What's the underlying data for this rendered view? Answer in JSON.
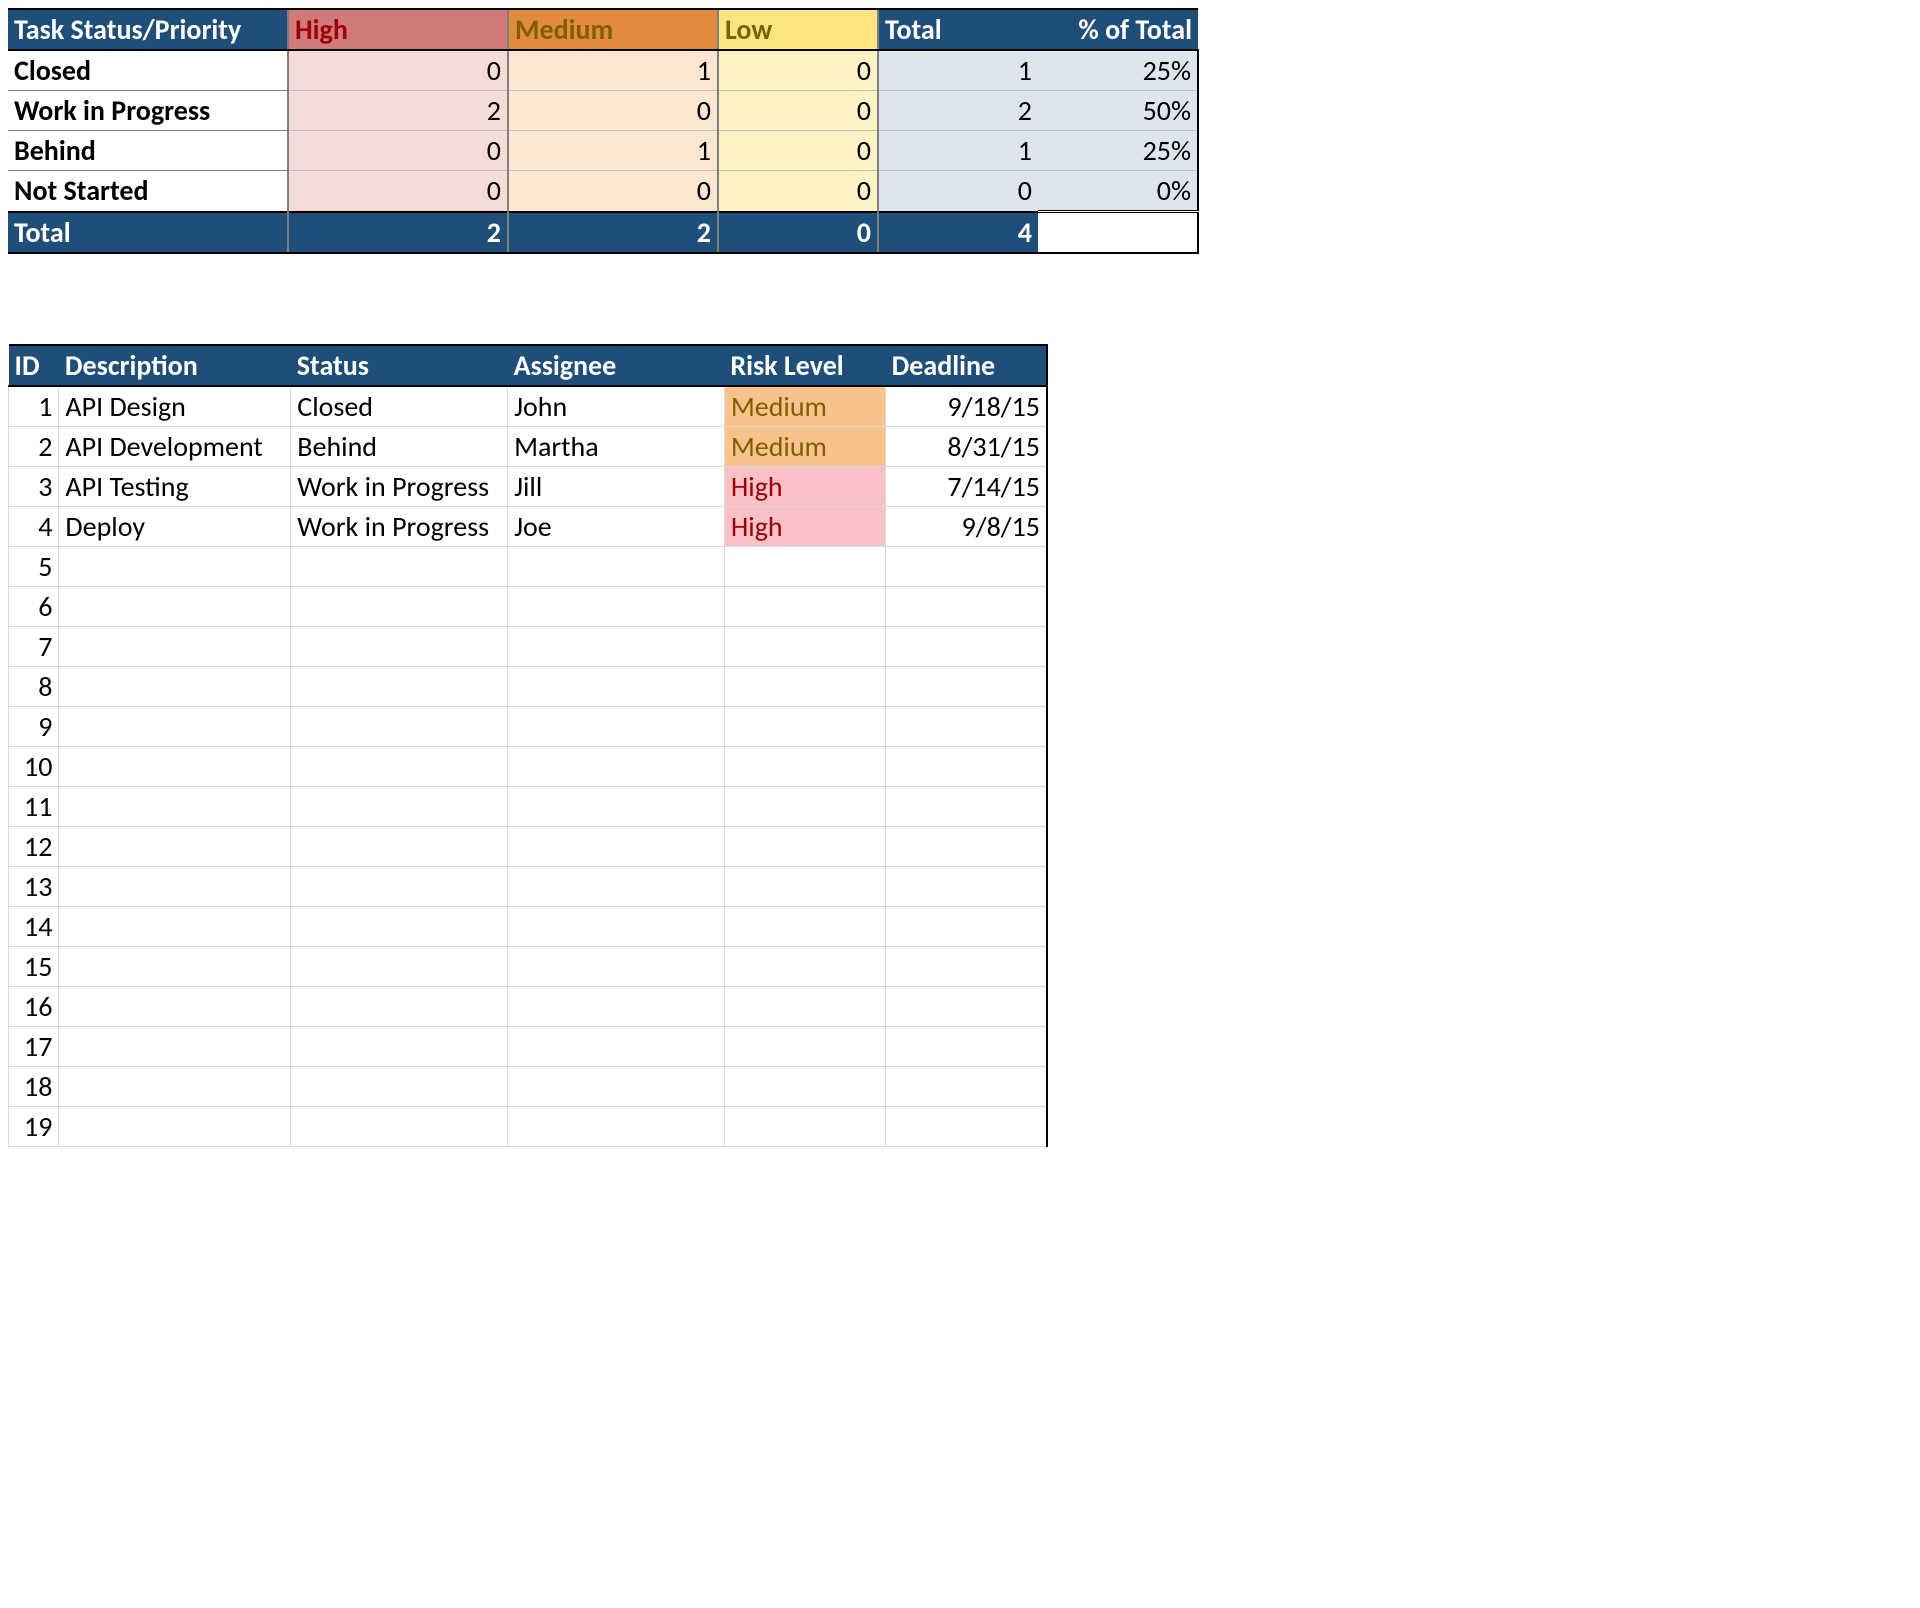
{
  "summary": {
    "headers": {
      "rowhead": "Task Status/Priority",
      "high": "High",
      "medium": "Medium",
      "low": "Low",
      "total": "Total",
      "pct": "% of Total"
    },
    "rows": [
      {
        "label": "Closed",
        "high": "0",
        "medium": "1",
        "low": "0",
        "total": "1",
        "pct": "25%"
      },
      {
        "label": "Work in Progress",
        "high": "2",
        "medium": "0",
        "low": "0",
        "total": "2",
        "pct": "50%"
      },
      {
        "label": "Behind",
        "high": "0",
        "medium": "1",
        "low": "0",
        "total": "1",
        "pct": "25%"
      },
      {
        "label": "Not Started",
        "high": "0",
        "medium": "0",
        "low": "0",
        "total": "0",
        "pct": "0%"
      }
    ],
    "totals": {
      "label": "Total",
      "high": "2",
      "medium": "2",
      "low": "0",
      "total": "4",
      "pct": ""
    }
  },
  "detail": {
    "headers": {
      "id": "ID",
      "desc": "Description",
      "status": "Status",
      "assignee": "Assignee",
      "risk": "Risk Level",
      "deadline": "Deadline"
    },
    "rows": [
      {
        "id": "1",
        "desc": "API Design",
        "status": "Closed",
        "assignee": "John",
        "risk": "Medium",
        "risk_class": "risk-med",
        "deadline": "9/18/15"
      },
      {
        "id": "2",
        "desc": "API Development",
        "status": "Behind",
        "assignee": "Martha",
        "risk": "Medium",
        "risk_class": "risk-med",
        "deadline": "8/31/15"
      },
      {
        "id": "3",
        "desc": "API Testing",
        "status": "Work in Progress",
        "assignee": "Jill",
        "risk": "High",
        "risk_class": "risk-high",
        "deadline": "7/14/15"
      },
      {
        "id": "4",
        "desc": "Deploy",
        "status": "Work in Progress",
        "assignee": "Joe",
        "risk": "High",
        "risk_class": "risk-high",
        "deadline": "9/8/15"
      }
    ],
    "empty_ids": [
      "5",
      "6",
      "7",
      "8",
      "9",
      "10",
      "11",
      "12",
      "13",
      "14",
      "15",
      "16",
      "17",
      "18",
      "19"
    ]
  }
}
